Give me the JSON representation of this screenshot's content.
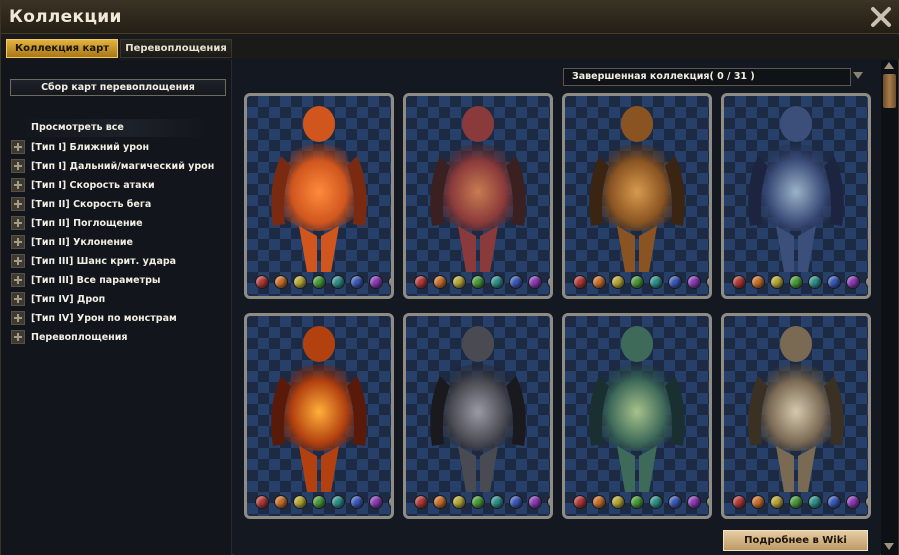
{
  "window": {
    "title": "Коллекции"
  },
  "tabs": [
    {
      "label": "Коллекция карт",
      "active": true
    },
    {
      "label": "Перевоплощения",
      "active": false
    }
  ],
  "left_panel": {
    "collect_button": "Сбор карт перевоплощения",
    "view_all": "Просмотреть все",
    "items": [
      {
        "label": "[Тип I] Ближний урон"
      },
      {
        "label": "[Тип I] Дальний/магический урон"
      },
      {
        "label": "[Тип I] Скорость атаки"
      },
      {
        "label": "[Тип II] Скорость бега"
      },
      {
        "label": "[Тип II] Поглощение"
      },
      {
        "label": "[Тип II] Уклонение"
      },
      {
        "label": "[Тип III] Шанс крит. удара"
      },
      {
        "label": "[Тип III] Все параметры"
      },
      {
        "label": "[Тип IV] Дроп"
      },
      {
        "label": "[Тип IV] Урон по монстрам"
      },
      {
        "label": "Перевоплощения"
      }
    ]
  },
  "filter": {
    "selected": "Завершенная коллекция( 0 / 31 )"
  },
  "gem_colors": [
    "#b23a3a",
    "#c8702e",
    "#b5a63a",
    "#4a9a3c",
    "#2f8f8a",
    "#3a59b8",
    "#8a3bb5",
    "#6a6a6a"
  ],
  "cards": [
    {
      "name": "card-flame-demoness",
      "palette": [
        "#7a2a10",
        "#d0561e",
        "#ff8a3c"
      ]
    },
    {
      "name": "card-horned-warrior",
      "palette": [
        "#3a2020",
        "#8a3a3a",
        "#c97b50"
      ]
    },
    {
      "name": "card-ram-knight",
      "palette": [
        "#3a2412",
        "#8a5422",
        "#d79a4c"
      ]
    },
    {
      "name": "card-dark-sorceress",
      "palette": [
        "#1d2440",
        "#3c4e7a",
        "#9ab3c9"
      ]
    },
    {
      "name": "card-fire-golem",
      "palette": [
        "#5a1a0a",
        "#b3400f",
        "#ffb03a"
      ]
    },
    {
      "name": "card-black-knight",
      "palette": [
        "#1a1a1e",
        "#4a4a52",
        "#9a9aa6"
      ]
    },
    {
      "name": "card-forest-archer",
      "palette": [
        "#1a3030",
        "#3e6a5a",
        "#a7c28a"
      ]
    },
    {
      "name": "card-holy-valkyrie",
      "palette": [
        "#3a3024",
        "#7a6a54",
        "#d6c8ae"
      ]
    }
  ],
  "wiki_button": "Подробнее в Wiki",
  "icons": {
    "close": "close-x-icon",
    "expand": "plus-icon",
    "dropdown": "chevron-down-icon"
  }
}
